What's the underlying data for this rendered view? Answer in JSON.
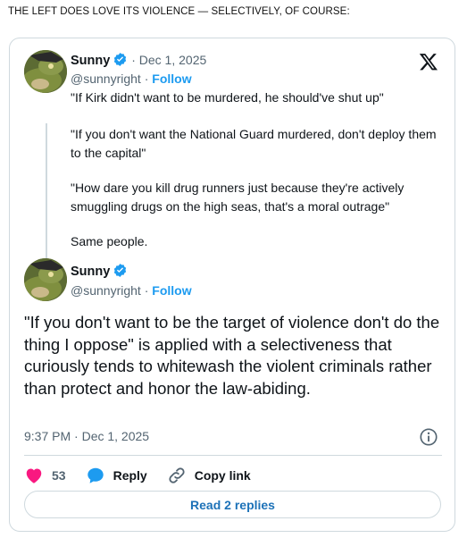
{
  "headline": "THE LEFT DOES LOVE ITS VIOLENCE — SELECTIVELY, OF COURSE:",
  "colors": {
    "accent": "#1d9bf0",
    "like": "#f91880",
    "border": "#cfd9de",
    "muted": "#536471"
  },
  "quoted_tweet": {
    "author_name": "Sunny",
    "date": "Dec 1, 2025",
    "handle": "@sunnyright",
    "follow_label": "Follow",
    "paragraphs": [
      "\"If Kirk didn't want to be murdered, he should've shut up\"",
      "\"If you don't want the National Guard murdered, don't deploy them to the capital\"",
      "\"How dare you kill drug runners just because they're actively smuggling drugs on the high seas, that's a moral outrage\"",
      "Same people."
    ]
  },
  "main_tweet": {
    "author_name": "Sunny",
    "handle": "@sunnyright",
    "follow_label": "Follow",
    "text": "\"If you don't want to be the target of violence don't do the thing I oppose\" is applied with a selectiveness that curiously tends to whitewash the violent criminals rather than protect and honor the law-abiding.",
    "timestamp": "9:37 PM · Dec 1, 2025",
    "likes": "53",
    "reply_label": "Reply",
    "copy_link_label": "Copy link",
    "read_replies_label": "Read 2 replies"
  },
  "icons": {
    "platform": "x-logo-icon",
    "verified": "verified-badge-icon",
    "info": "info-icon",
    "like": "heart-icon",
    "reply": "reply-bubble-icon",
    "copy": "link-icon"
  }
}
